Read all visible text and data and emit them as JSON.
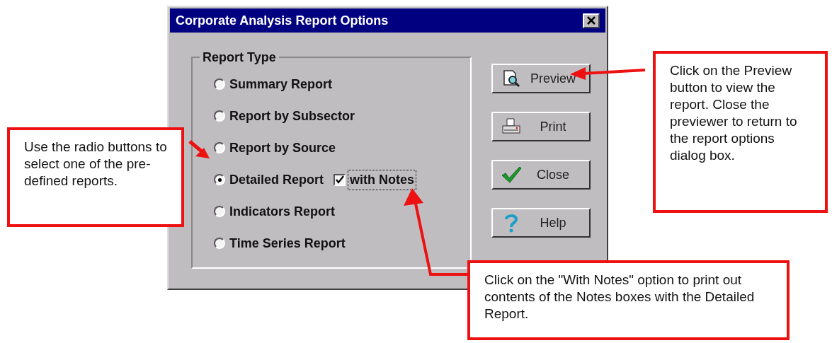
{
  "window": {
    "title": "Corporate Analysis Report Options"
  },
  "report_type": {
    "title": "Report Type",
    "options": [
      {
        "label": "Summary Report",
        "selected": false
      },
      {
        "label": "Report by Subsector",
        "selected": false
      },
      {
        "label": "Report by Source",
        "selected": false
      },
      {
        "label": "Detailed Report",
        "selected": true,
        "option": {
          "label": "with Notes",
          "checked": true
        }
      },
      {
        "label": "Indicators Report",
        "selected": false
      },
      {
        "label": "Time Series Report",
        "selected": false
      }
    ]
  },
  "buttons": [
    {
      "label": "Preview",
      "kind": "preview"
    },
    {
      "label": "Print",
      "kind": "print"
    },
    {
      "label": "Close",
      "kind": "check"
    },
    {
      "label": "Help",
      "kind": "help"
    }
  ],
  "callouts": [
    {
      "kind": "left",
      "text": "Use the radio buttons to select one of the pre-defined reports."
    },
    {
      "kind": "right",
      "text": "Click on the Preview button to view the report. Close the previewer to return to the report options dialog box."
    },
    {
      "kind": "bottom",
      "text": "Click on the \"With Notes\" option to print out contents of the Notes boxes with the Detailed Report."
    }
  ]
}
